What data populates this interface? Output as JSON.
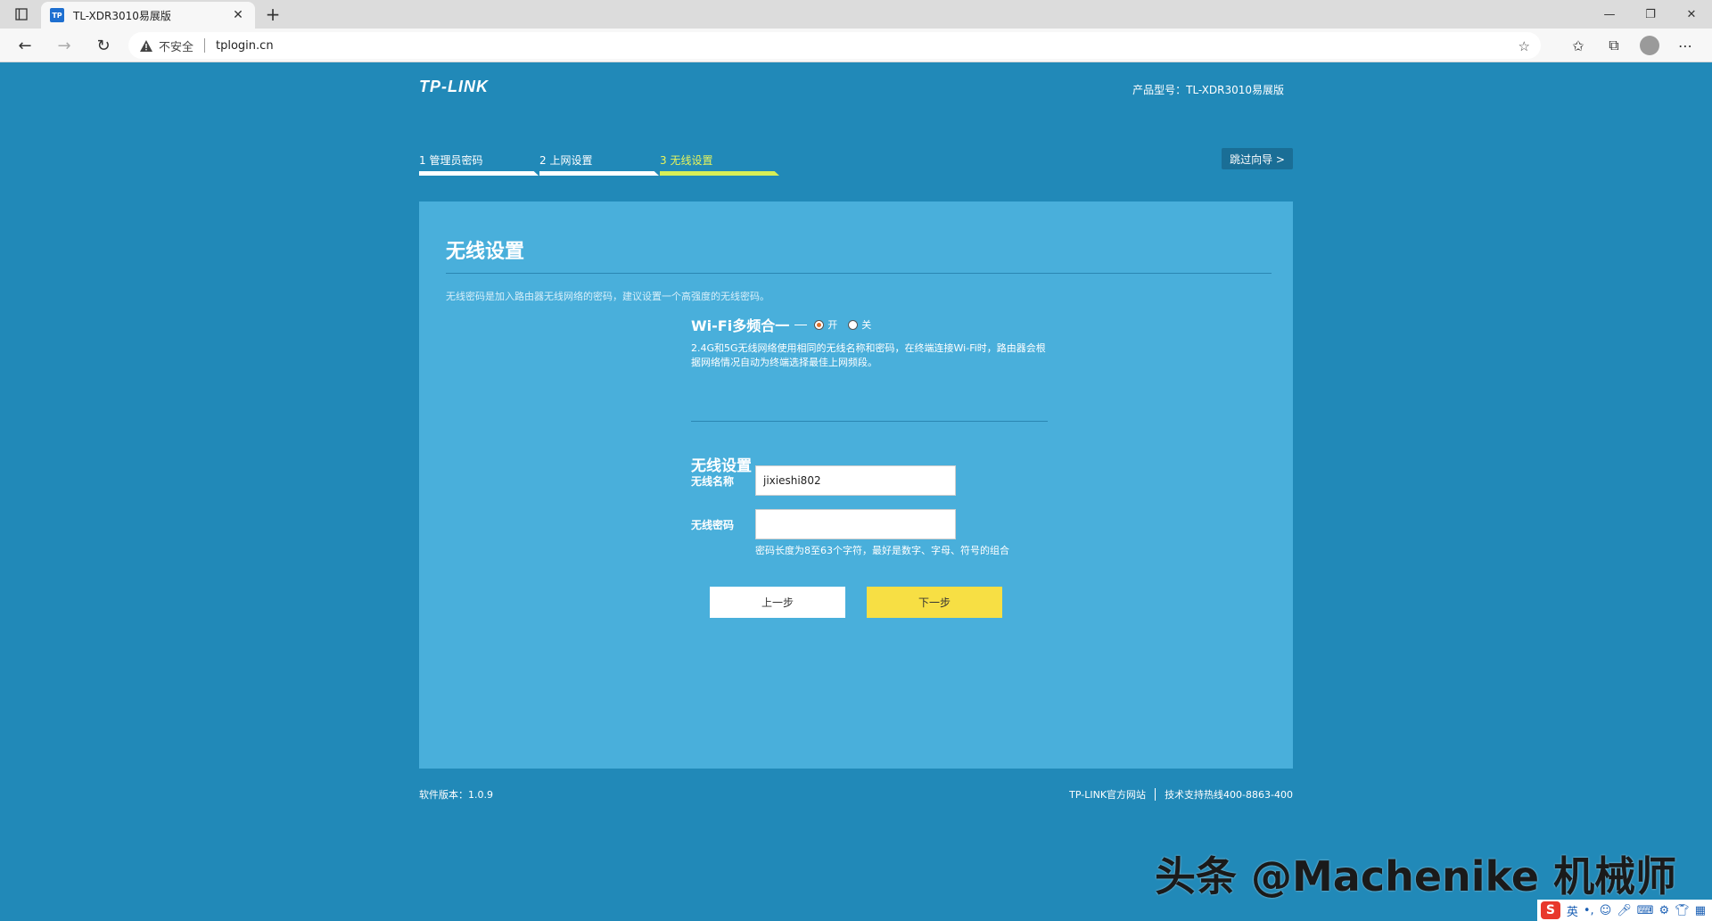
{
  "browser": {
    "tab_title": "TL-XDR3010易展版",
    "tab_favicon_text": "TP",
    "insecure_label": "不安全",
    "url": "tplogin.cn",
    "icons": {
      "tab_actions": "tab-actions-icon",
      "close": "close-icon",
      "new_tab": "plus-icon",
      "back": "back-arrow-icon",
      "forward": "forward-arrow-icon",
      "refresh": "refresh-icon",
      "warning": "warning-icon",
      "favorite_add": "star-plus-icon",
      "favorites": "favorites-icon",
      "collections": "collections-icon",
      "profile": "avatar-icon",
      "menu": "more-icon"
    }
  },
  "header": {
    "logo": "TP-LINK",
    "model": "产品型号：TL-XDR3010易展版"
  },
  "steps": [
    {
      "label": "1 管理员密码",
      "active": false
    },
    {
      "label": "2 上网设置",
      "active": false
    },
    {
      "label": "3 无线设置",
      "active": true
    }
  ],
  "skip_button": "跳过向导 >",
  "panel": {
    "title": "无线设置",
    "description": "无线密码是加入路由器无线网络的密码，建议设置一个高强度的无线密码。",
    "wifi_merge": {
      "label": "Wi-Fi多频合一",
      "on_label": "开",
      "off_label": "关",
      "selected": "开",
      "note": "2.4G和5G无线网络使用相同的无线名称和密码，在终端连接Wi-Fi时，路由器会根据网络情况自动为终端选择最佳上网频段。"
    },
    "wireless_section_title": "无线设置",
    "ssid_label": "无线名称",
    "ssid_value": "jixieshi802",
    "password_label": "无线密码",
    "password_value": "",
    "password_hint": "密码长度为8至63个字符，最好是数字、字母、符号的组合",
    "prev_button": "上一步",
    "next_button": "下一步"
  },
  "footer": {
    "version": "软件版本：1.0.9",
    "official_site": "TP-LINK官方网站",
    "hotline": "技术支持热线400-8863-400"
  },
  "watermark": "头条 @Machenike 机械师",
  "ime": {
    "logo": "S",
    "lang": "英"
  },
  "colors": {
    "page_bg": "#2189b8",
    "panel_bg": "#49afdb",
    "active_step": "#d7ef56",
    "next_button": "#f7df44"
  }
}
